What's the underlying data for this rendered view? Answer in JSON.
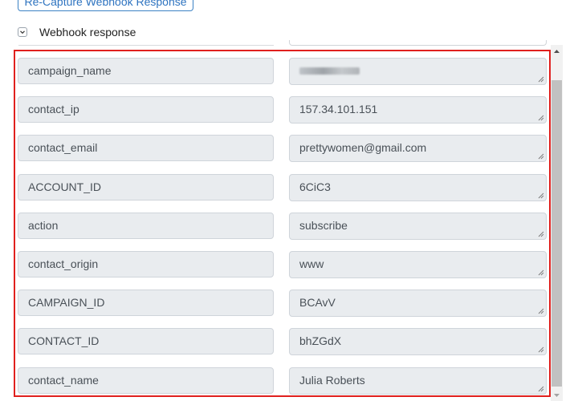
{
  "toolbar": {
    "recapture_label": "Re-Capture Webhook Response"
  },
  "section": {
    "toggle_label": "Webhook response",
    "expanded": true
  },
  "fields": [
    {
      "key": "campaign_name",
      "value": "",
      "value_obscured": true
    },
    {
      "key": "contact_ip",
      "value": "157.34.101.151"
    },
    {
      "key": "contact_email",
      "value": "prettywomen@gmail.com"
    },
    {
      "key": "ACCOUNT_ID",
      "value": "6CiC3"
    },
    {
      "key": "action",
      "value": "subscribe"
    },
    {
      "key": "contact_origin",
      "value": "www"
    },
    {
      "key": "CAMPAIGN_ID",
      "value": "BCAvV"
    },
    {
      "key": "CONTACT_ID",
      "value": "bhZGdX"
    },
    {
      "key": "contact_name",
      "value": "Julia Roberts"
    }
  ],
  "colors": {
    "highlight": "#e0201e",
    "accent": "#2f74c0",
    "field_bg": "#e9ecef"
  }
}
